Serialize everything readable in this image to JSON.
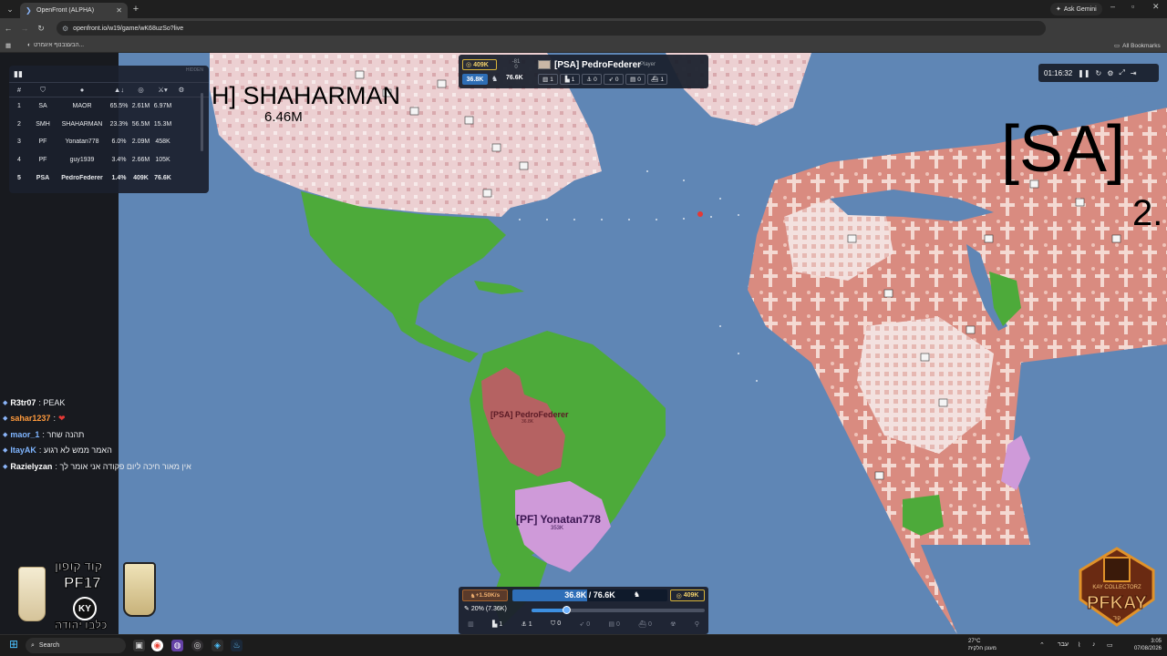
{
  "browser": {
    "tab_title": "OpenFront (ALPHA)",
    "url": "openfront.io/w19/game/wK68uzSo?live",
    "ask_gemini": "Ask Gemini",
    "bookmark_item": "הבעצבנוף איגמרט...",
    "all_bookmarks": "All Bookmarks"
  },
  "leaderboard": {
    "hidden_label": "HIDDEN",
    "headers": {
      "rank": "#"
    },
    "rows": [
      {
        "rank": "1",
        "tag": "SA",
        "name": "MAOR",
        "land": "65.5%",
        "gold": "2.61M",
        "troops": "6.97M"
      },
      {
        "rank": "2",
        "tag": "SMH",
        "name": "SHAHARMAN",
        "land": "23.3%",
        "gold": "56.5M",
        "troops": "15.3M"
      },
      {
        "rank": "3",
        "tag": "PF",
        "name": "Yonatan778",
        "land": "6.0%",
        "gold": "2.09M",
        "troops": "458K"
      },
      {
        "rank": "4",
        "tag": "PF",
        "name": "guy1939",
        "land": "3.4%",
        "gold": "2.66M",
        "troops": "105K"
      },
      {
        "rank": "5",
        "tag": "PSA",
        "name": "PedroFederer",
        "land": "1.4%",
        "gold": "409K",
        "troops": "76.6K"
      }
    ]
  },
  "player_panel": {
    "gold": "409K",
    "troops": "36.8K",
    "max_troops": "76.6K",
    "relation_top": "-81",
    "relation_bottom": "0",
    "name": "[PSA] PedroFederer",
    "type": "Player",
    "stats": [
      "1",
      "1",
      "0",
      "0",
      "0",
      "1"
    ]
  },
  "timer": {
    "time": "01:16:32"
  },
  "map_labels": {
    "shaharman_name": "H] SHAHARMAN",
    "shaharman_troops": "6.46M",
    "sa_name": "[SA]",
    "sa_sub": "2.",
    "psa_name": "[PSA] PedroFederer",
    "psa_troops": "36.8K",
    "pf_name": "[PF] Yonatan778",
    "pf_troops": "353K"
  },
  "chat": [
    {
      "name": "R3tr07",
      "name_color": "#ffffff",
      "msg": " : PEAK"
    },
    {
      "name": "sahar1237",
      "name_color": "#ff9a3c",
      "msg": " : "
    },
    {
      "name": "maor_1",
      "name_color": "#7fb5ff",
      "msg": " : תהנה שחר"
    },
    {
      "name": "ItayAK",
      "name_color": "#7fb5ff",
      "msg": " : האמר ממש לא רגוע"
    },
    {
      "name": "Razielyzan",
      "name_color": "#ffffff",
      "msg": " : אין מאור חיכה ליום פקודה אני אומר לך"
    }
  ],
  "control_bar": {
    "income": "+1.50K/s",
    "troops_current": "36.8K",
    "troops_max": "76.6K",
    "troops_fraction": 0.48,
    "gold": "409K",
    "ratio_label": "20% (7.36K)",
    "ratio_fraction": 0.2,
    "build_counts": [
      "1",
      "1",
      "0",
      "0",
      "0",
      "0"
    ]
  },
  "ads": {
    "left_line1": "קוד קופון",
    "left_line2": "PF17",
    "left_badge": "KY",
    "left_line3": "כלבו יהודה",
    "right_line1": "KAY COLLECTORZ",
    "right_line2": "PFKAY",
    "right_line3": "קוד"
  },
  "taskbar": {
    "search": "Search",
    "weather_temp": "27°C",
    "weather_desc": "מעונן חלקית",
    "lang": "עבר",
    "time": "3:05",
    "date": "07/08/2026"
  },
  "colors": {
    "ocean": "#5f86b5",
    "green_territory": "#4daa3a",
    "pink_territory": "#e9c6c9",
    "salmon_territory": "#d98b80",
    "purple_territory": "#cf9ad9",
    "psa_territory": "#c8566a"
  }
}
